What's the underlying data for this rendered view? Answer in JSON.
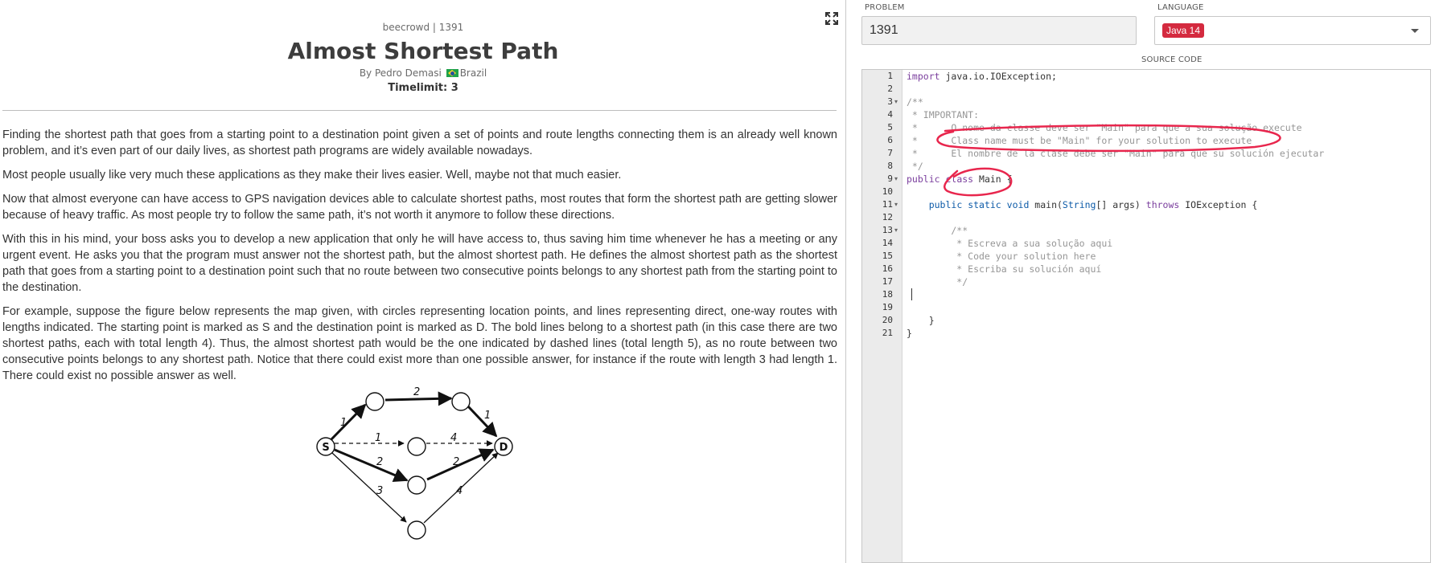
{
  "problem": {
    "source": "beecrowd | 1391",
    "title": "Almost Shortest Path",
    "author_prefix": "By Pedro Demasi",
    "country": "Brazil",
    "timelimit": "Timelimit: 3",
    "paragraphs": [
      "Finding the shortest path that goes from a starting point to a destination point given a set of points and route lengths connecting them is an already well known problem, and it’s even part of our daily lives, as shortest path programs are widely available nowadays.",
      "Most people usually like very much these applications as they make their lives easier. Well, maybe not that much easier.",
      "Now that almost everyone can have access to GPS navigation devices able to calculate shortest paths, most routes that form the shortest path are getting slower because of heavy traffic. As most people try to follow the same path, it’s not worth it anymore to follow these directions.",
      "With this in his mind, your boss asks you to develop a new application that only he will have access to, thus saving him time whenever he has a meeting or any urgent event. He asks you that the program must answer not the shortest path, but the almost shortest path. He defines the almost shortest path as the shortest path that goes from a starting point to a destination point such that no route between two consecutive points belongs to any shortest path from the starting point to the destination.",
      "For example, suppose the figure below represents the map given, with circles representing location points, and lines representing direct, one-way routes with lengths indicated. The starting point is marked as S and the destination point is marked as D. The bold lines belong to a shortest path (in this case there are two shortest paths, each with total length 4). Thus, the almost shortest path would be the one indicated by dashed lines (total length 5), as no route between two consecutive points belongs to any shortest path. Notice that there could exist more than one possible answer, for instance if the route with length 3 had length 1. There could exist no possible answer as well."
    ],
    "figure": {
      "start_label": "S",
      "dest_label": "D",
      "edge_weights": [
        "1",
        "2",
        "1",
        "1",
        "4",
        "2",
        "2",
        "3",
        "4"
      ]
    }
  },
  "form": {
    "problem_label": "PROBLEM",
    "problem_value": "1391",
    "language_label": "LANGUAGE",
    "language_value": "Java 14",
    "source_label": "SOURCE CODE"
  },
  "editor": {
    "line_numbers": [
      "1",
      "2",
      "3",
      "4",
      "5",
      "6",
      "7",
      "8",
      "9",
      "10",
      "11",
      "12",
      "13",
      "14",
      "15",
      "16",
      "17",
      "18",
      "19",
      "20",
      "21"
    ],
    "code": {
      "l1_kw": "import",
      "l1_rest": " java.io.IOException;",
      "l3": "/**",
      "l4": " * IMPORTANT:",
      "l5": " *      O nome da classe deve ser \"Main\" para que a sua solução execute",
      "l6": " *      Class name must be \"Main\" for your solution to execute",
      "l7": " *      El nombre de la clase debe ser \"Main\" para que su solución ejecutar",
      "l8": " */",
      "l9_kw1": "public",
      "l9_kw2": "class",
      "l9_rest": " Main {",
      "l11_indent": "    ",
      "l11_kw1": "public",
      "l11_kw2": "static",
      "l11_kw3": "void",
      "l11_mid1": " main(",
      "l11_type": "String",
      "l11_mid2": "[] args) ",
      "l11_kw4": "throws",
      "l11_rest": " IOException {",
      "l13": "        /**",
      "l14": "         * Escreva a sua solução aqui",
      "l15": "         * Code your solution here",
      "l16": "         * Escriba su solución aquí",
      "l17": "         */",
      "l19": "    }",
      "l21": "}"
    }
  },
  "colors": {
    "language_tag": "#d42a3f",
    "annotation": "#e8264d",
    "keyword": "#7a3e9d"
  }
}
